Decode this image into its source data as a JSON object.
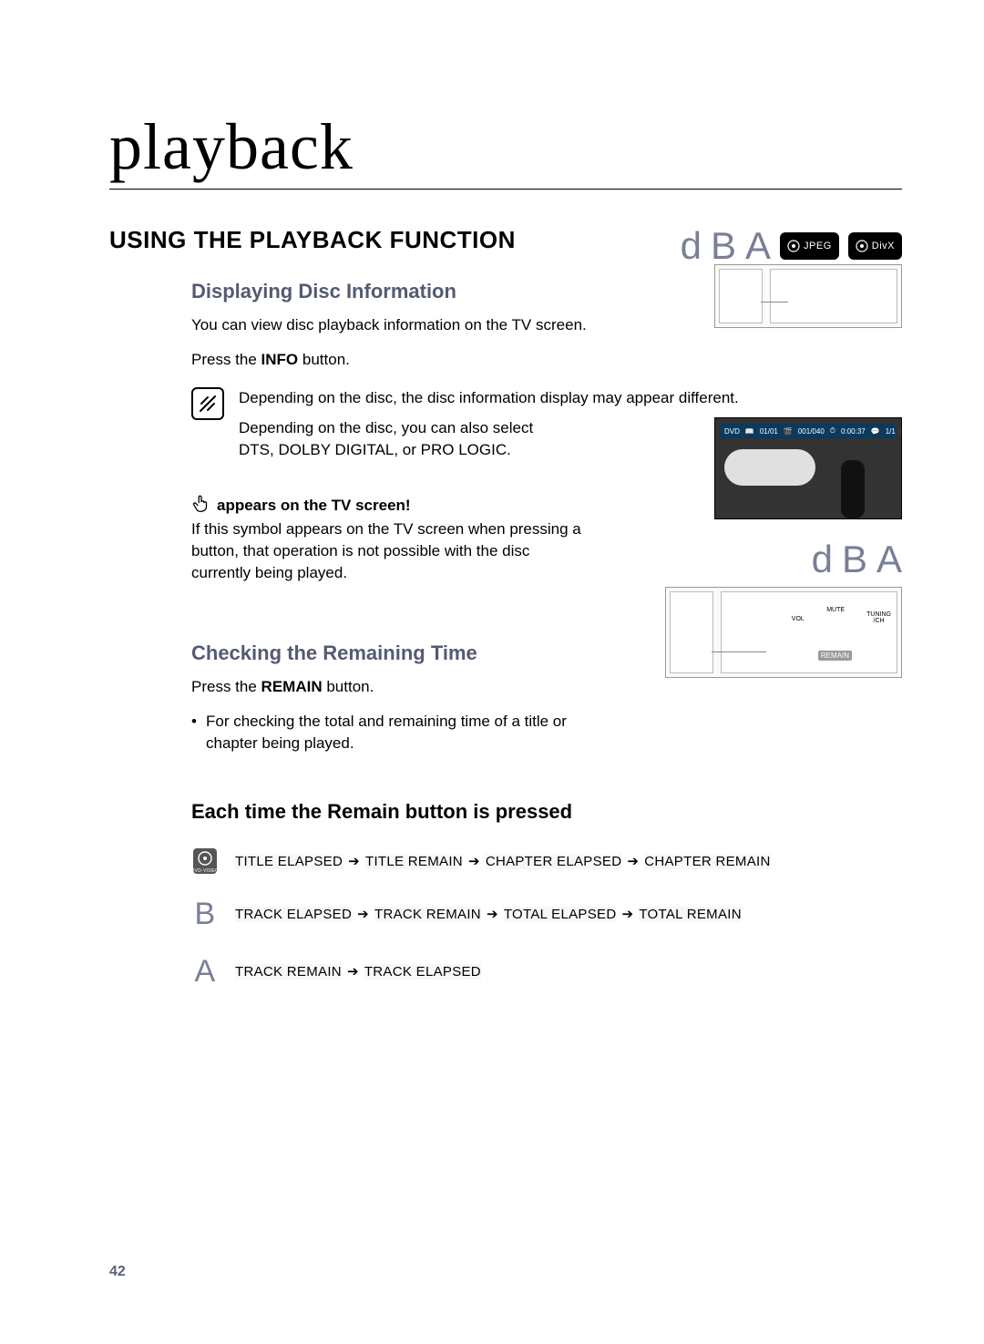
{
  "chapterTitle": "playback",
  "sectionHeading": "USING THE PLAYBACK FUNCTION",
  "iconsTopRight": {
    "letters": [
      "d",
      "B",
      "A"
    ],
    "jpegLabel": "JPEG",
    "divxLabel": "DivX"
  },
  "discInfo": {
    "heading": "Displaying Disc Information",
    "intro": "You can view disc playback information  on the TV screen.",
    "press_pre": "Press the ",
    "press_btn": "INFO",
    "press_post": " button."
  },
  "note": {
    "line1": "Depending on the disc, the disc information display may appear different.",
    "line2": "Depending on the disc, you can also select",
    "line3": "DTS, DOLBY DIGITAL, or PRO LOGIC."
  },
  "tvWarn": {
    "heading": "appears on the TV screen!",
    "body": "If this symbol appears on the TV screen when pressing a button, that operation is not possible with the disc currently being played."
  },
  "tvBar": {
    "dvd": "DVD",
    "title": "01/01",
    "chap": "001/040",
    "time": "0:00:37",
    "sub": "1/1"
  },
  "remain": {
    "heading": "Checking the Remaining Time",
    "iconsLetters": [
      "d",
      "B",
      "A"
    ],
    "press_pre": "Press the ",
    "press_btn": "REMAIN",
    "press_post": " button.",
    "bullet": "For checking the total and remaining time of a title or chapter being played.",
    "remoteLabels": {
      "vol": "VOL",
      "mute": "MUTE",
      "remain": "REMAIN",
      "tuning": "TUNING",
      "ch": "/CH"
    }
  },
  "each": {
    "heading": "Each time the Remain button is pressed",
    "seqDvd": [
      "TITLE ELAPSED",
      "TITLE REMAIN",
      "CHAPTER ELAPSED",
      "CHAPTER REMAIN"
    ],
    "seqB": [
      "TRACK ELAPSED",
      "TRACK REMAIN",
      "TOTAL ELAPSED",
      "TOTAL REMAIN"
    ],
    "seqA": [
      "TRACK REMAIN",
      "TRACK ELAPSED"
    ]
  },
  "pageNumber": "42"
}
